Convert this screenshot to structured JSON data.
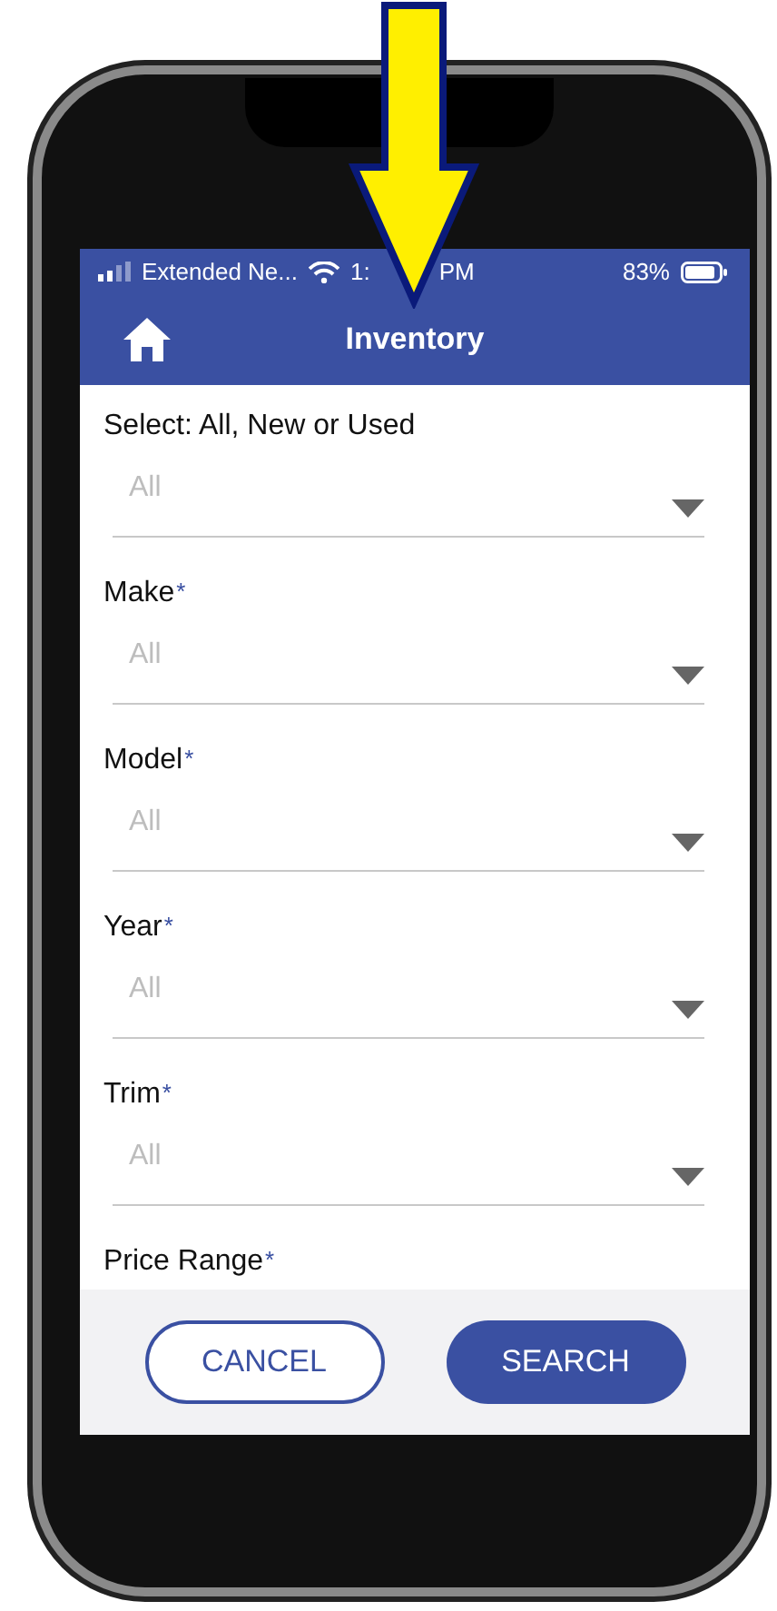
{
  "status_bar": {
    "carrier": "Extended Ne...",
    "time_start": "1:",
    "time_end": "PM",
    "battery": "83%"
  },
  "header": {
    "title": "Inventory"
  },
  "fields": [
    {
      "label": "Select: All, New or Used",
      "value": "All"
    },
    {
      "label": "Make",
      "marker": "*",
      "value": "All"
    },
    {
      "label": "Model",
      "marker": "*",
      "value": "All"
    },
    {
      "label": "Year",
      "marker": "*",
      "value": "All"
    },
    {
      "label": "Trim",
      "marker": "*",
      "value": "All"
    },
    {
      "label": "Price Range",
      "marker": "*"
    }
  ],
  "buttons": [
    {
      "label": "CANCEL",
      "kind": "outline"
    },
    {
      "label": "SEARCH",
      "kind": "filled"
    }
  ]
}
